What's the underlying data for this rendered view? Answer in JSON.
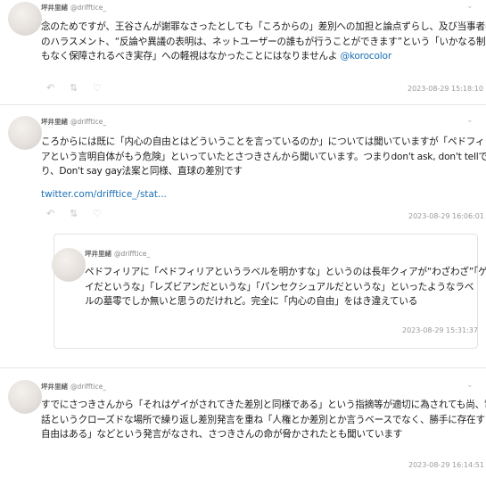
{
  "tweets": [
    {
      "name": "坪井里緒",
      "handle": "@drifftice_",
      "lines": [
        "念のためですが、王谷さんが謝罪なさったとしても「ころからの」差別への加担と論点ずらし、及び当事者へ",
        "のハラスメント、“反論や異議の表明は、ネットユーザーの誰もが行うことができます”という「いかなる制限",
        "もなく保障されるべき実存」への軽視はなかったことにはなりませんよ"
      ],
      "mention": "@korocolor",
      "timestamp": "2023-08-29 15:18:10"
    },
    {
      "name": "坪井里緒",
      "handle": "@drifftice_",
      "lines": [
        "ころからには既に「内心の自由とはどういうことを言っているのか」については聞いていますが「ペドフィリ",
        "アという言明自体がもう危険」といっていたとさつきさんから聞いています。つまりdon't ask, don't tellであ",
        "り、Don't say gay法案と同様、直球の差別です"
      ],
      "link": "twitter.com/drifftice_/stat...",
      "timestamp": "2023-08-29 16:06:01"
    },
    {
      "name": "坪井里緒",
      "handle": "@drifftice_",
      "lines": [
        "ペドフィリアに「ペドフィリアというラベルを明かすな」というのは長年クィアが“わざわざ”「ゲ",
        "イだというな」「レズビアンだというな」「パンセクシュアルだというな」といったようなラベ",
        "ルの墓零でしか無いと思うのだけれど。完全に「内心の自由」をはき違えている"
      ],
      "timestamp": "2023-08-29 15:31:37"
    },
    {
      "name": "坪井里緒",
      "handle": "@drifftice_",
      "lines": [
        "すでにさつきさんから「それはゲイがされてきた差別と同様である」という指摘等が適切に為されても尚、電",
        "話というクローズドな場所で繰り返し差別発言を重ね「人権とか差別とか言うベースでなく、勝手に存在する",
        "自由はある」などという発言がなされ、さつきさんの命が脅かされたとも聞いています"
      ],
      "timestamp": "2023-08-29 16:14:51"
    }
  ],
  "icons": {
    "reply": "reply-icon",
    "retweet": "retweet-icon",
    "like": "heart-icon",
    "menu": "chevron-down-icon"
  },
  "colors": {
    "link": "#1b6fb5",
    "muted": "#9a9a9a",
    "divider": "#e6e6e6"
  }
}
